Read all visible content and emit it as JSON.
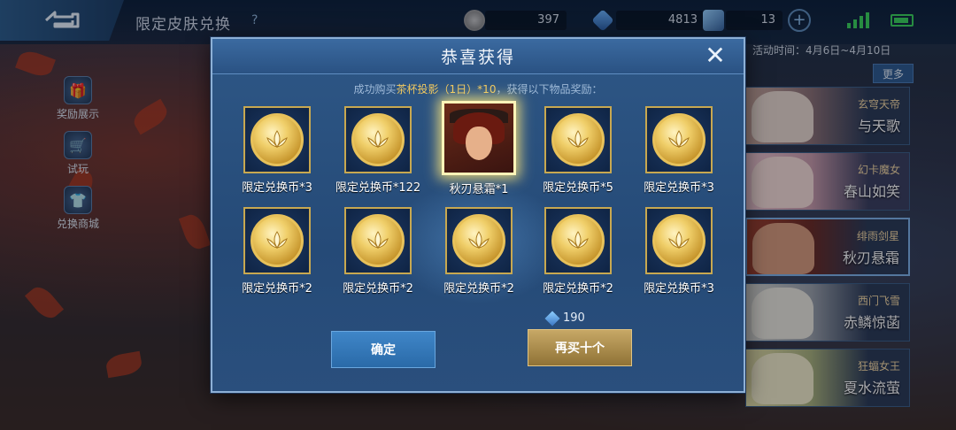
{
  "topbar": {
    "title": "限定皮肤兑换",
    "help": "?",
    "resources": [
      {
        "name": "coin",
        "value": "397"
      },
      {
        "name": "diamond",
        "value": "4813"
      },
      {
        "name": "token",
        "value": "13"
      }
    ],
    "plus": "+"
  },
  "sidebar": {
    "items": [
      {
        "label": "奖励展示",
        "icon": "gift-icon"
      },
      {
        "label": "试玩",
        "icon": "cart-icon"
      },
      {
        "label": "兑换商城",
        "icon": "shirt-icon"
      }
    ]
  },
  "right_panel": {
    "activity_time": "活动时间：4月6日~4月10日",
    "more": "更多",
    "skins": [
      {
        "sub": "玄穹天帝",
        "name": "与天歌"
      },
      {
        "sub": "幻卡魔女",
        "name": "春山如笑"
      },
      {
        "sub": "绯雨剑星",
        "name": "秋刃悬霜"
      },
      {
        "sub": "西门飞雪",
        "name": "赤鳞惊菡"
      },
      {
        "sub": "狂蝠女王",
        "name": "夏水流萤"
      }
    ]
  },
  "modal": {
    "title": "恭喜获得",
    "close": "✕",
    "subtitle_prefix": "成功购买",
    "subtitle_item": "茶杯投影（1日）*10",
    "subtitle_suffix": "，获得以下物品奖励：",
    "rewards": [
      {
        "label": "限定兑换币*3",
        "type": "coin"
      },
      {
        "label": "限定兑换币*122",
        "type": "coin"
      },
      {
        "label": "秋刃悬霜*1",
        "type": "skin"
      },
      {
        "label": "限定兑换币*5",
        "type": "coin"
      },
      {
        "label": "限定兑换币*3",
        "type": "coin"
      },
      {
        "label": "限定兑换币*2",
        "type": "coin"
      },
      {
        "label": "限定兑换币*2",
        "type": "coin"
      },
      {
        "label": "限定兑换币*2",
        "type": "coin"
      },
      {
        "label": "限定兑换币*2",
        "type": "coin"
      },
      {
        "label": "限定兑换币*3",
        "type": "coin"
      }
    ],
    "cost": "190",
    "confirm_label": "确定",
    "buy_again_label": "再买十个"
  }
}
